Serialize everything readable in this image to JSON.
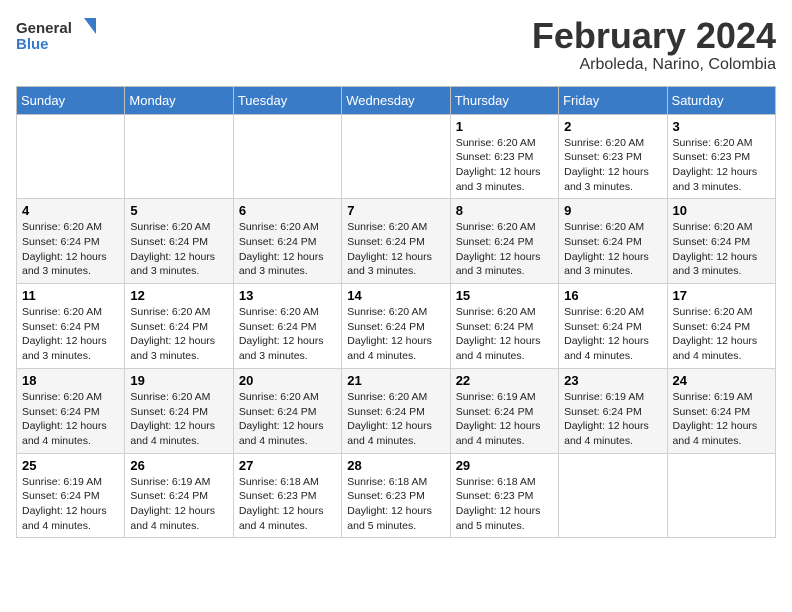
{
  "logo": {
    "general": "General",
    "blue": "Blue"
  },
  "title": "February 2024",
  "subtitle": "Arboleda, Narino, Colombia",
  "days_header": [
    "Sunday",
    "Monday",
    "Tuesday",
    "Wednesday",
    "Thursday",
    "Friday",
    "Saturday"
  ],
  "weeks": [
    [
      {
        "day": "",
        "info": ""
      },
      {
        "day": "",
        "info": ""
      },
      {
        "day": "",
        "info": ""
      },
      {
        "day": "",
        "info": ""
      },
      {
        "day": "1",
        "info": "Sunrise: 6:20 AM\nSunset: 6:23 PM\nDaylight: 12 hours\nand 3 minutes."
      },
      {
        "day": "2",
        "info": "Sunrise: 6:20 AM\nSunset: 6:23 PM\nDaylight: 12 hours\nand 3 minutes."
      },
      {
        "day": "3",
        "info": "Sunrise: 6:20 AM\nSunset: 6:23 PM\nDaylight: 12 hours\nand 3 minutes."
      }
    ],
    [
      {
        "day": "4",
        "info": "Sunrise: 6:20 AM\nSunset: 6:24 PM\nDaylight: 12 hours\nand 3 minutes."
      },
      {
        "day": "5",
        "info": "Sunrise: 6:20 AM\nSunset: 6:24 PM\nDaylight: 12 hours\nand 3 minutes."
      },
      {
        "day": "6",
        "info": "Sunrise: 6:20 AM\nSunset: 6:24 PM\nDaylight: 12 hours\nand 3 minutes."
      },
      {
        "day": "7",
        "info": "Sunrise: 6:20 AM\nSunset: 6:24 PM\nDaylight: 12 hours\nand 3 minutes."
      },
      {
        "day": "8",
        "info": "Sunrise: 6:20 AM\nSunset: 6:24 PM\nDaylight: 12 hours\nand 3 minutes."
      },
      {
        "day": "9",
        "info": "Sunrise: 6:20 AM\nSunset: 6:24 PM\nDaylight: 12 hours\nand 3 minutes."
      },
      {
        "day": "10",
        "info": "Sunrise: 6:20 AM\nSunset: 6:24 PM\nDaylight: 12 hours\nand 3 minutes."
      }
    ],
    [
      {
        "day": "11",
        "info": "Sunrise: 6:20 AM\nSunset: 6:24 PM\nDaylight: 12 hours\nand 3 minutes."
      },
      {
        "day": "12",
        "info": "Sunrise: 6:20 AM\nSunset: 6:24 PM\nDaylight: 12 hours\nand 3 minutes."
      },
      {
        "day": "13",
        "info": "Sunrise: 6:20 AM\nSunset: 6:24 PM\nDaylight: 12 hours\nand 3 minutes."
      },
      {
        "day": "14",
        "info": "Sunrise: 6:20 AM\nSunset: 6:24 PM\nDaylight: 12 hours\nand 4 minutes."
      },
      {
        "day": "15",
        "info": "Sunrise: 6:20 AM\nSunset: 6:24 PM\nDaylight: 12 hours\nand 4 minutes."
      },
      {
        "day": "16",
        "info": "Sunrise: 6:20 AM\nSunset: 6:24 PM\nDaylight: 12 hours\nand 4 minutes."
      },
      {
        "day": "17",
        "info": "Sunrise: 6:20 AM\nSunset: 6:24 PM\nDaylight: 12 hours\nand 4 minutes."
      }
    ],
    [
      {
        "day": "18",
        "info": "Sunrise: 6:20 AM\nSunset: 6:24 PM\nDaylight: 12 hours\nand 4 minutes."
      },
      {
        "day": "19",
        "info": "Sunrise: 6:20 AM\nSunset: 6:24 PM\nDaylight: 12 hours\nand 4 minutes."
      },
      {
        "day": "20",
        "info": "Sunrise: 6:20 AM\nSunset: 6:24 PM\nDaylight: 12 hours\nand 4 minutes."
      },
      {
        "day": "21",
        "info": "Sunrise: 6:20 AM\nSunset: 6:24 PM\nDaylight: 12 hours\nand 4 minutes."
      },
      {
        "day": "22",
        "info": "Sunrise: 6:19 AM\nSunset: 6:24 PM\nDaylight: 12 hours\nand 4 minutes."
      },
      {
        "day": "23",
        "info": "Sunrise: 6:19 AM\nSunset: 6:24 PM\nDaylight: 12 hours\nand 4 minutes."
      },
      {
        "day": "24",
        "info": "Sunrise: 6:19 AM\nSunset: 6:24 PM\nDaylight: 12 hours\nand 4 minutes."
      }
    ],
    [
      {
        "day": "25",
        "info": "Sunrise: 6:19 AM\nSunset: 6:24 PM\nDaylight: 12 hours\nand 4 minutes."
      },
      {
        "day": "26",
        "info": "Sunrise: 6:19 AM\nSunset: 6:24 PM\nDaylight: 12 hours\nand 4 minutes."
      },
      {
        "day": "27",
        "info": "Sunrise: 6:18 AM\nSunset: 6:23 PM\nDaylight: 12 hours\nand 4 minutes."
      },
      {
        "day": "28",
        "info": "Sunrise: 6:18 AM\nSunset: 6:23 PM\nDaylight: 12 hours\nand 5 minutes."
      },
      {
        "day": "29",
        "info": "Sunrise: 6:18 AM\nSunset: 6:23 PM\nDaylight: 12 hours\nand 5 minutes."
      },
      {
        "day": "",
        "info": ""
      },
      {
        "day": "",
        "info": ""
      }
    ]
  ]
}
